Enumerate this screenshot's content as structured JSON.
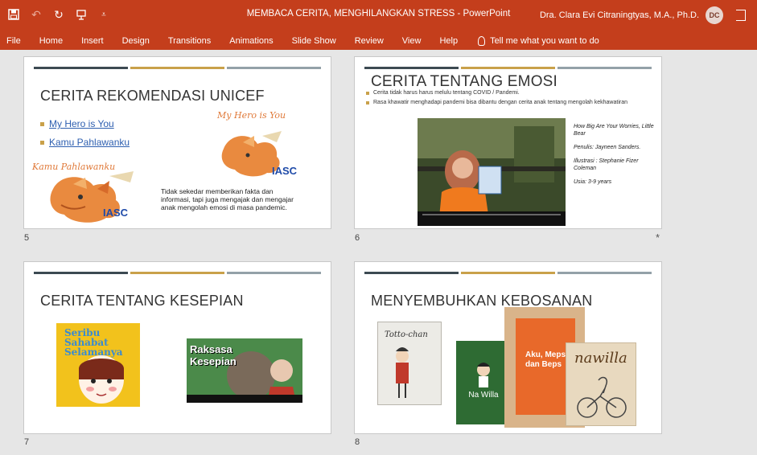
{
  "titlebar": {
    "doc_title": "MEMBACA CERITA, MENGHILANGKAN STRESS - PowerPoint",
    "user_name": "Dra. Clara Evi Citraningtyas, M.A., Ph.D.",
    "user_initials": "DC"
  },
  "menu": {
    "file": "File",
    "home": "Home",
    "insert": "Insert",
    "design": "Design",
    "transitions": "Transitions",
    "animations": "Animations",
    "slideshow": "Slide Show",
    "review": "Review",
    "view": "View",
    "help": "Help",
    "tell_me": "Tell me what you want to do"
  },
  "slides": {
    "s5": {
      "number": "5",
      "title": "CERITA  REKOMENDASI UNICEF",
      "link1": "My Hero is You",
      "link2": "Kamu Pahlawanku",
      "body": "Tidak sekedar memberikan fakta dan informasi, tapi juga mengajak dan mengajar anak mengolah emosi di masa pandemic.",
      "book_en": "My Hero is You",
      "book_id": "Kamu Pahlawanku",
      "logo": "IASC"
    },
    "s6": {
      "number": "6",
      "title": "CERITA TENTANG EMOSI",
      "bullet1": "Cerita tidak harus harus melulu tentang COVID / Pandemi.",
      "bullet2": "Rasa khawatir menghadapi pandemi bisa dibantu dengan cerita anak tentang mengolah kekhawatiran",
      "info_title": "How Big  Are Your Worries, Little Bear",
      "info_author": "Penulis: Jayneen Sanders.",
      "info_illustrator": "Illustrasi : Stephanie Fizer Coleman",
      "info_age": "Usia: 3-9 years",
      "star": "*"
    },
    "s7": {
      "number": "7",
      "title": "CERITA TENTANG KESEPIAN",
      "book1": "Seribu Sahabat Selamanya",
      "book2": "Raksasa Kesepian"
    },
    "s8": {
      "number": "8",
      "title": "MENYEMBUHKAN  KEBOSANAN",
      "book1": "Totto-chan",
      "book2": "Na Willa",
      "book3": "Aku, Meps, dan Beps",
      "book4": "nawilla"
    }
  },
  "colors": {
    "ribbon": "#c43e1c",
    "bar_dark": "#3c4a52",
    "bar_gold": "#c9a14a",
    "bar_grey": "#93a1a8"
  }
}
